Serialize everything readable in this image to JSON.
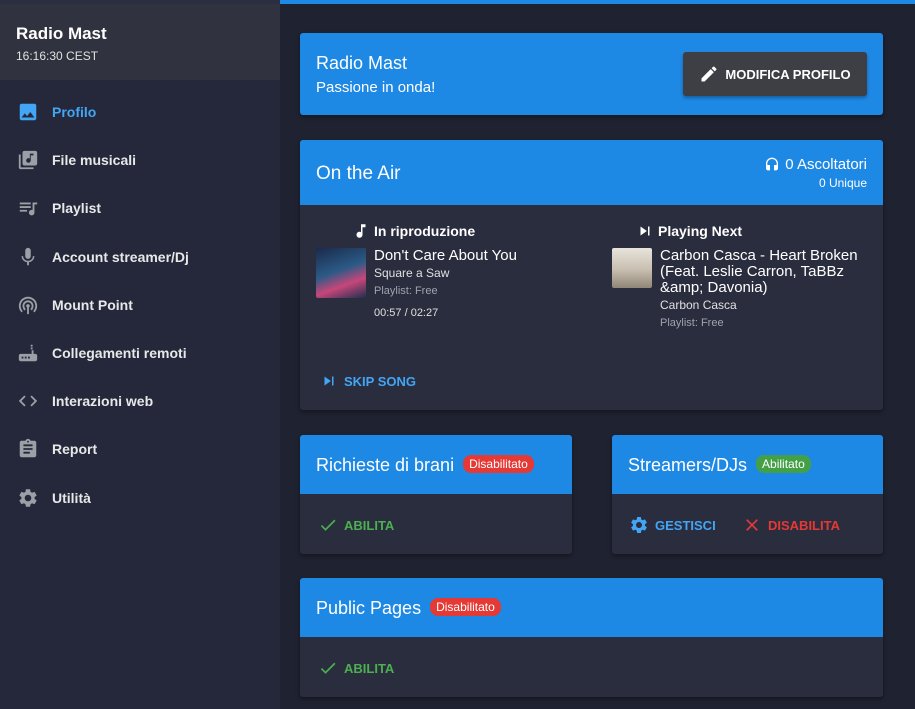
{
  "station": {
    "name": "Radio Mast",
    "time": "16:16:30 CEST"
  },
  "sidebar": {
    "items": [
      {
        "label": "Profilo",
        "icon": "image-icon",
        "active": true
      },
      {
        "label": "File musicali",
        "icon": "library-music-icon"
      },
      {
        "label": "Playlist",
        "icon": "queue-music-icon"
      },
      {
        "label": "Account streamer/Dj",
        "icon": "mic-icon"
      },
      {
        "label": "Mount Point",
        "icon": "broadcast-icon"
      },
      {
        "label": "Collegamenti remoti",
        "icon": "router-icon"
      },
      {
        "label": "Interazioni web",
        "icon": "code-icon"
      },
      {
        "label": "Report",
        "icon": "clipboard-icon"
      },
      {
        "label": "Utilità",
        "icon": "settings-icon"
      }
    ]
  },
  "profile": {
    "name": "Radio Mast",
    "tagline": "Passione in onda!",
    "edit_label": "MODIFICA PROFILO"
  },
  "onair": {
    "title": "On the Air",
    "listeners": "0 Ascoltatori",
    "unique": "0 Unique",
    "now": {
      "heading": "In riproduzione",
      "title": "Don't Care About You",
      "artist": "Square a Saw",
      "playlist": "Playlist: Free",
      "elapsed": "00:57 / 02:27"
    },
    "next": {
      "heading": "Playing Next",
      "title": "Carbon Casca - Heart Broken (Feat. Leslie Carron, TaBBz &amp; Davonia)",
      "artist": "Carbon Casca",
      "playlist": "Playlist: Free"
    },
    "skip_label": "SKIP SONG"
  },
  "requests": {
    "title": "Richieste di brani",
    "badge": "Disabilitato",
    "action": "ABILITA"
  },
  "streamers": {
    "title": "Streamers/DJs",
    "badge": "Abilitato",
    "manage": "GESTISCI",
    "disable": "DISABILITA"
  },
  "public_pages": {
    "title": "Public Pages",
    "badge": "Disabilitato",
    "action": "ABILITA"
  },
  "colors": {
    "accent": "#1e88e5",
    "background": "#1f2231",
    "card": "#2a2d3e",
    "success": "#4caf50",
    "danger": "#e53935"
  }
}
